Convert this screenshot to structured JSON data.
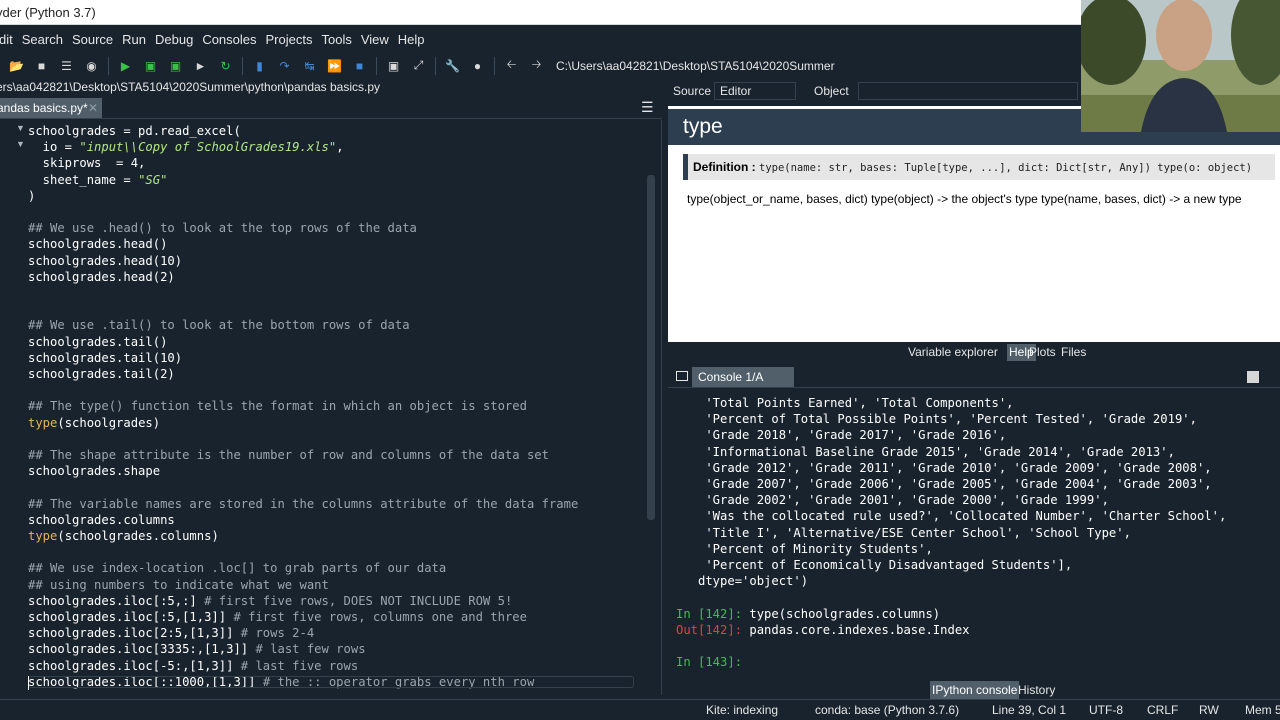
{
  "window": {
    "title": "yder (Python 3.7)"
  },
  "menu": [
    "dit",
    "Search",
    "Source",
    "Run",
    "Debug",
    "Consoles",
    "Projects",
    "Tools",
    "View",
    "Help"
  ],
  "toolbar": {
    "working_dir": "C:\\Users\\aa042821\\Desktop\\STA5104\\2020Summer"
  },
  "editor": {
    "file_path": "ers\\aa042821\\Desktop\\STA5104\\2020Summer\\python\\pandas basics.py",
    "tab_label": "andas basics.py*",
    "tab_close": "✕",
    "menu_glyph": "☰",
    "lines": [
      [
        [
          "schoolgrades = pd.read_excel(",
          "code"
        ]
      ],
      [
        [
          "  io = ",
          "code"
        ],
        [
          "\"input\\\\Copy of SchoolGrades19.xls\"",
          "str"
        ],
        [
          ",",
          "code"
        ]
      ],
      [
        [
          "  skiprows  = 4,",
          "code"
        ]
      ],
      [
        [
          "  sheet_name = ",
          "code"
        ],
        [
          "\"SG\"",
          "str"
        ]
      ],
      [
        [
          ")",
          "code"
        ]
      ],
      [
        [
          "",
          "code"
        ]
      ],
      [
        [
          "## We use .head() to look at the top rows of the data",
          "comment"
        ]
      ],
      [
        [
          "schoolgrades.head()",
          "code"
        ]
      ],
      [
        [
          "schoolgrades.head(10)",
          "code"
        ]
      ],
      [
        [
          "schoolgrades.head(2)",
          "code"
        ]
      ],
      [
        [
          "",
          "code"
        ]
      ],
      [
        [
          "",
          "code"
        ]
      ],
      [
        [
          "## We use .tail() to look at the bottom rows of data",
          "comment"
        ]
      ],
      [
        [
          "schoolgrades.tail()",
          "code"
        ]
      ],
      [
        [
          "schoolgrades.tail(10)",
          "code"
        ]
      ],
      [
        [
          "schoolgrades.tail(2)",
          "code"
        ]
      ],
      [
        [
          "",
          "code"
        ]
      ],
      [
        [
          "## The type() function tells the format in which an object is stored",
          "comment"
        ]
      ],
      [
        [
          "type",
          "kw"
        ],
        [
          "(schoolgrades)",
          "code"
        ]
      ],
      [
        [
          "",
          "code"
        ]
      ],
      [
        [
          "## The shape attribute is the number of row and columns of the data set",
          "comment"
        ]
      ],
      [
        [
          "schoolgrades.shape",
          "code"
        ]
      ],
      [
        [
          "",
          "code"
        ]
      ],
      [
        [
          "## The variable names are stored in the columns attribute of the data frame",
          "comment"
        ]
      ],
      [
        [
          "schoolgrades.columns",
          "code"
        ]
      ],
      [
        [
          "type",
          "kw"
        ],
        [
          "(schoolgrades.columns)",
          "code"
        ]
      ],
      [
        [
          "",
          "code"
        ]
      ],
      [
        [
          "## We use index-location .loc[] to grab parts of our data",
          "comment"
        ]
      ],
      [
        [
          "## using numbers to indicate what we want",
          "comment"
        ]
      ],
      [
        [
          "schoolgrades.iloc[:5,:] ",
          "code"
        ],
        [
          "# first five rows, DOES NOT INCLUDE ROW 5!",
          "comment"
        ]
      ],
      [
        [
          "schoolgrades.iloc[:5,[1,3]] ",
          "code"
        ],
        [
          "# first five rows, columns one and three",
          "comment"
        ]
      ],
      [
        [
          "schoolgrades.iloc[2:5,[1,3]] ",
          "code"
        ],
        [
          "# rows 2-4",
          "comment"
        ]
      ],
      [
        [
          "schoolgrades.iloc[3335:,[1,3]] ",
          "code"
        ],
        [
          "# last few rows",
          "comment"
        ]
      ],
      [
        [
          "schoolgrades.iloc[-5:,[1,3]] ",
          "code"
        ],
        [
          "# last five rows",
          "comment"
        ]
      ],
      [
        [
          "schoolgrades.iloc[::1000,[1,3]] ",
          "code"
        ],
        [
          "# the :: operator grabs every nth row",
          "comment"
        ]
      ]
    ]
  },
  "help": {
    "source_label": "Source",
    "source_value": "Editor",
    "object_label": "Object",
    "title": "type",
    "definition_label": "Definition :",
    "signature": "type(name: str, bases: Tuple[type, ...], dict: Dict[str, Any]) type(o: object)",
    "doc": "type(object_or_name, bases, dict) type(object) -> the object's type type(name, bases, dict) -> a new type",
    "tabs": [
      "Variable explorer",
      "Help",
      "Plots",
      "Files"
    ],
    "active_tab": "Help"
  },
  "console": {
    "tab_label": "Console 1/A",
    "lines": [
      [
        [
          "    'Total Points Earned', 'Total Components',",
          "code"
        ]
      ],
      [
        [
          "    'Percent of Total Possible Points', 'Percent Tested', 'Grade 2019',",
          "code"
        ]
      ],
      [
        [
          "    'Grade 2018', 'Grade 2017', 'Grade 2016',",
          "code"
        ]
      ],
      [
        [
          "    'Informational Baseline Grade 2015', 'Grade 2014', 'Grade 2013',",
          "code"
        ]
      ],
      [
        [
          "    'Grade 2012', 'Grade 2011', 'Grade 2010', 'Grade 2009', 'Grade 2008',",
          "code"
        ]
      ],
      [
        [
          "    'Grade 2007', 'Grade 2006', 'Grade 2005', 'Grade 2004', 'Grade 2003',",
          "code"
        ]
      ],
      [
        [
          "    'Grade 2002', 'Grade 2001', 'Grade 2000', 'Grade 1999',",
          "code"
        ]
      ],
      [
        [
          "    'Was the collocated rule used?', 'Collocated Number', 'Charter School',",
          "code"
        ]
      ],
      [
        [
          "    'Title I', 'Alternative/ESE Center School', 'School Type',",
          "code"
        ]
      ],
      [
        [
          "    'Percent of Minority Students',",
          "code"
        ]
      ],
      [
        [
          "    'Percent of Economically Disadvantaged Students'],",
          "code"
        ]
      ],
      [
        [
          "   dtype='object')",
          "code"
        ]
      ],
      [
        [
          "",
          "code"
        ]
      ],
      [
        [
          "In [142]: ",
          "green"
        ],
        [
          "type(schoolgrades.columns)",
          "code"
        ]
      ],
      [
        [
          "Out[142]: ",
          "red"
        ],
        [
          "pandas.core.indexes.base.Index",
          "code"
        ]
      ],
      [
        [
          "",
          "code"
        ]
      ],
      [
        [
          "In [143]: ",
          "green"
        ]
      ]
    ],
    "tabs": [
      "IPython console",
      "History"
    ],
    "active_tab": "IPython console"
  },
  "status": {
    "kite": "Kite: indexing",
    "conda": "conda: base (Python 3.7.6)",
    "position": "Line 39, Col 1",
    "encoding": "UTF-8",
    "eol": "CRLF",
    "permissions": "RW",
    "memory": "Mem 5"
  }
}
